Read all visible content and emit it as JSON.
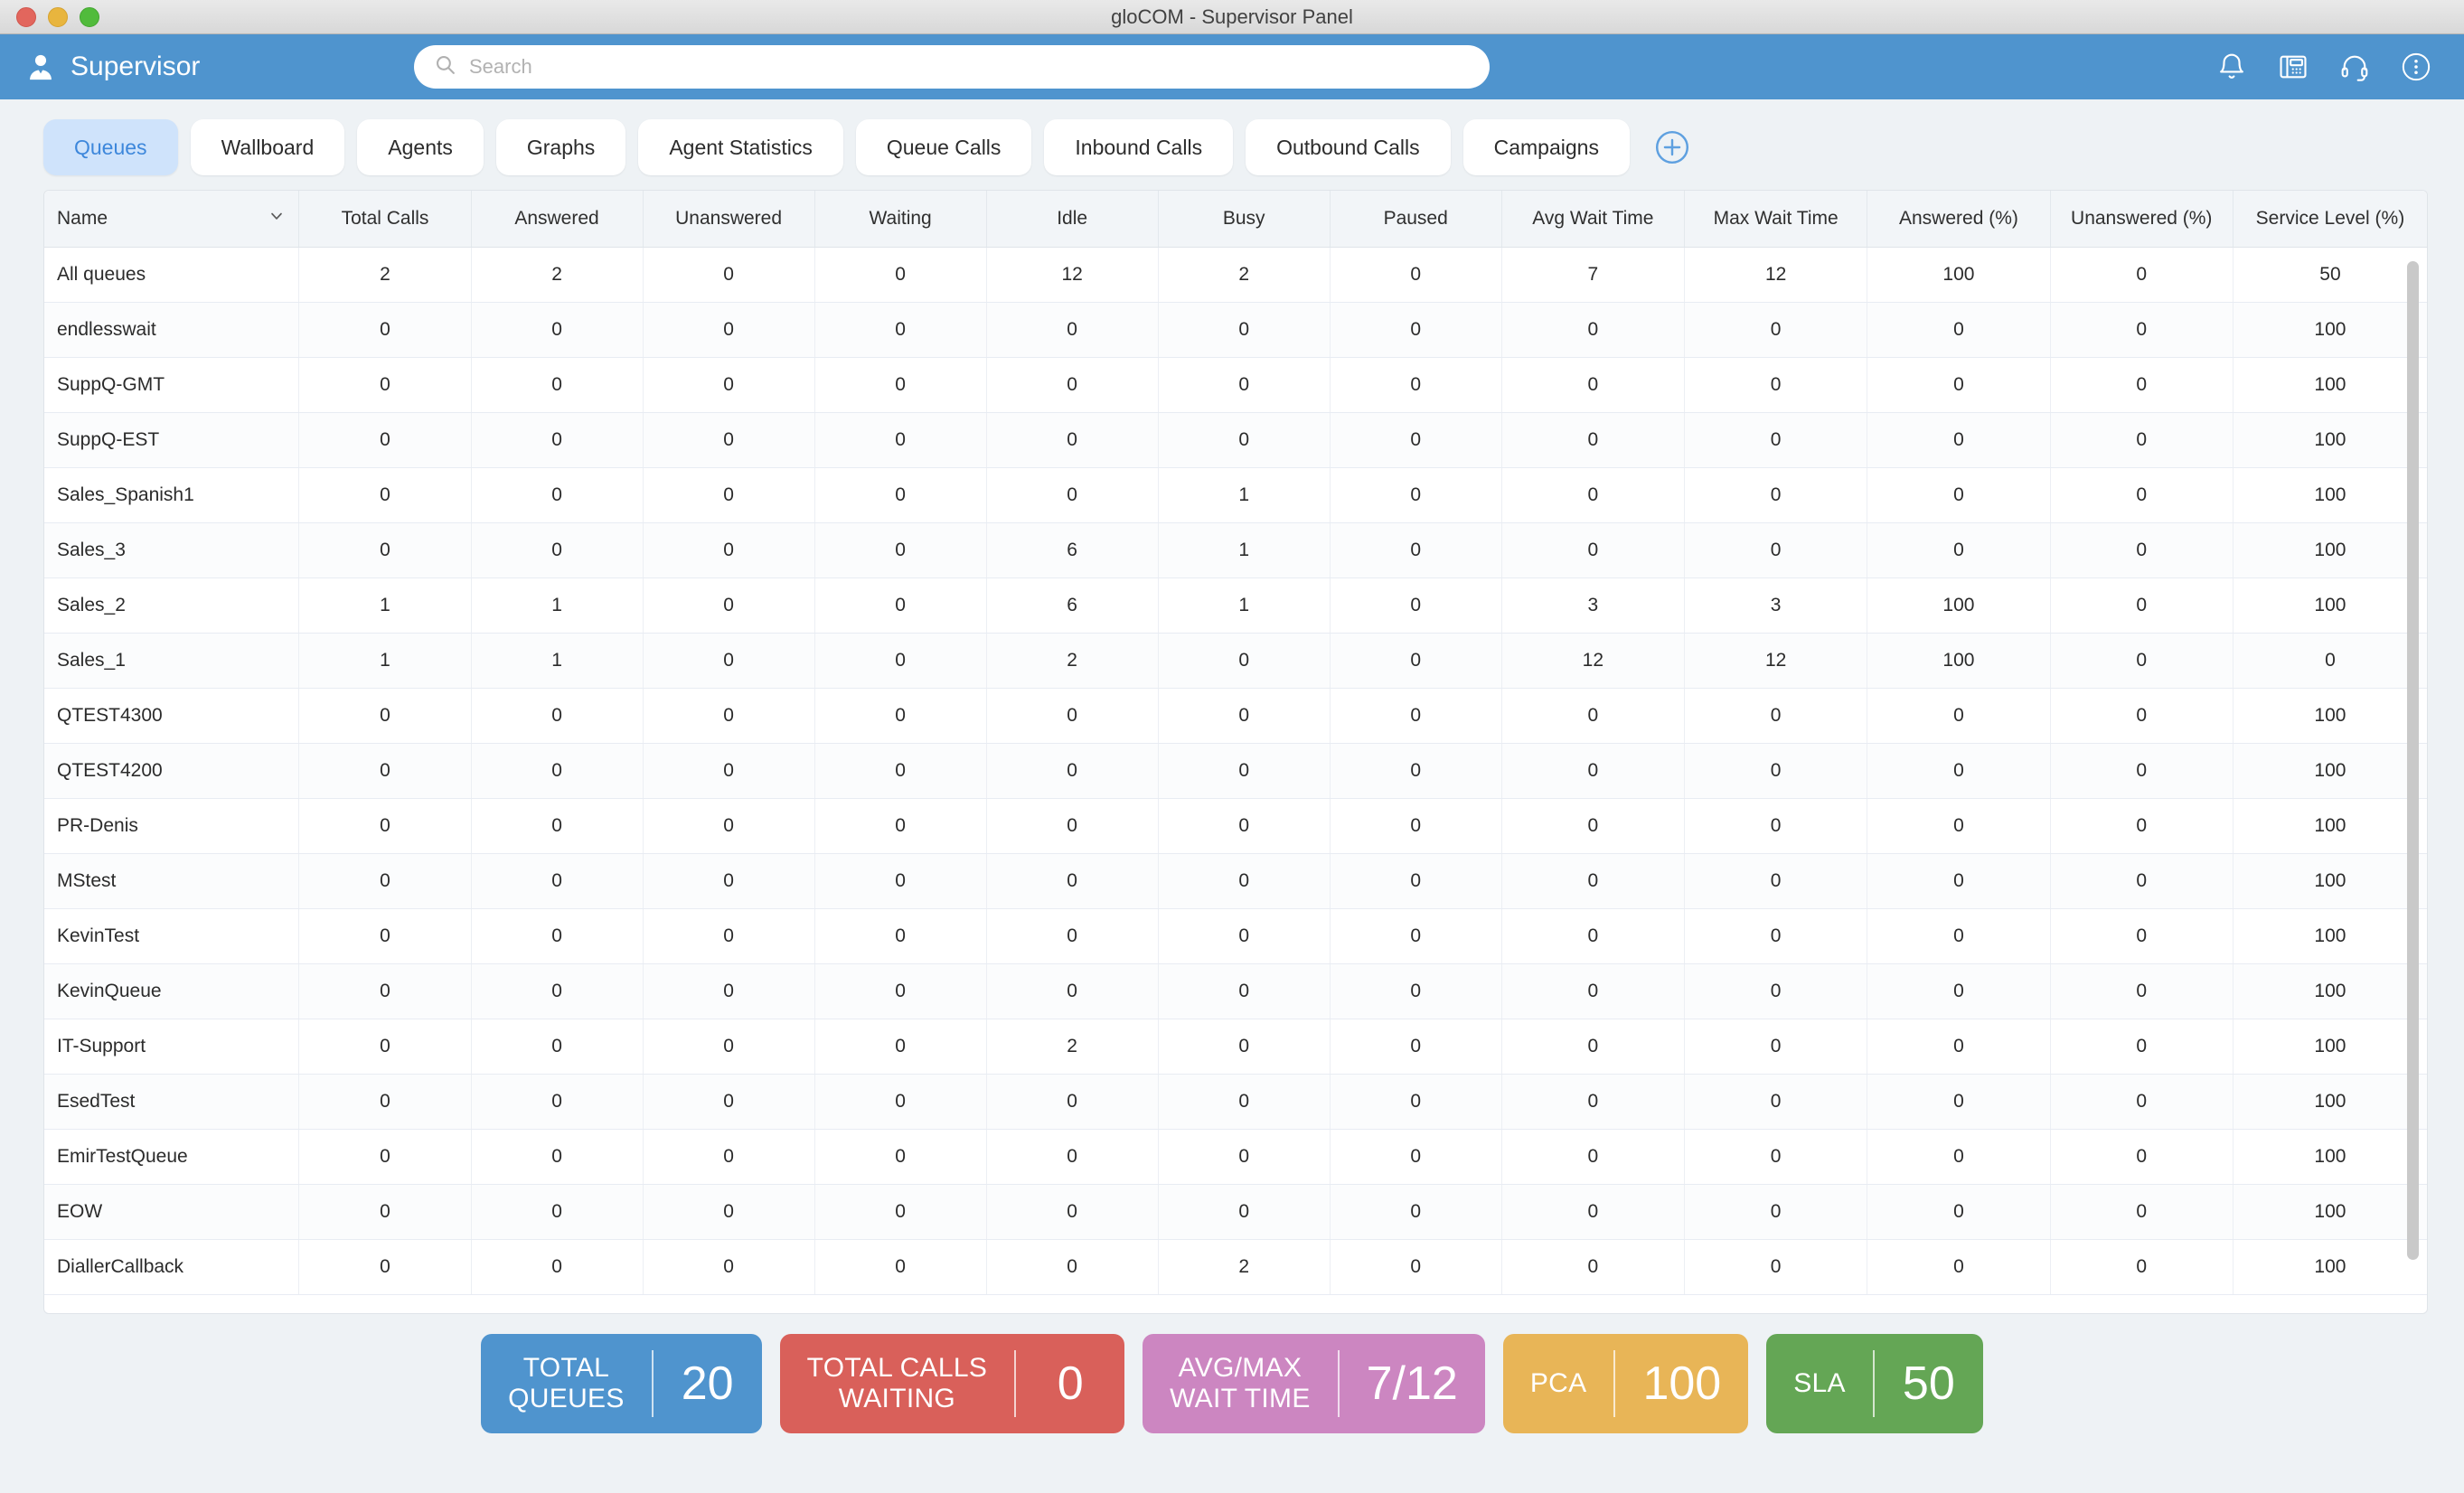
{
  "window": {
    "title": "gloCOM - Supervisor Panel",
    "controls": [
      "close",
      "minimize",
      "zoom"
    ]
  },
  "appbar": {
    "brand": "Supervisor",
    "brand_icon": "user-icon",
    "search": {
      "value": "",
      "placeholder": "Search",
      "icon": "search-icon"
    },
    "icons": [
      "bell-icon",
      "desk-phone-icon",
      "headset-icon",
      "more-options-icon"
    ],
    "background_color": "#4f94ce"
  },
  "tabs": {
    "items": [
      {
        "label": "Queues",
        "active": true
      },
      {
        "label": "Wallboard",
        "active": false
      },
      {
        "label": "Agents",
        "active": false
      },
      {
        "label": "Graphs",
        "active": false
      },
      {
        "label": "Agent Statistics",
        "active": false
      },
      {
        "label": "Queue Calls",
        "active": false
      },
      {
        "label": "Inbound Calls",
        "active": false
      },
      {
        "label": "Outbound Calls",
        "active": false
      },
      {
        "label": "Campaigns",
        "active": false
      }
    ],
    "add_tab_icon": "plus-circle-icon",
    "active_bg": "#cfe3fb",
    "active_fg": "#3d87db"
  },
  "table": {
    "sort_column": "Name",
    "sort_icon": "chevron-down-icon",
    "columns": [
      "Name",
      "Total Calls",
      "Answered",
      "Unanswered",
      "Waiting",
      "Idle",
      "Busy",
      "Paused",
      "Avg Wait Time",
      "Max Wait Time",
      "Answered (%)",
      "Unanswered (%)",
      "Service Level (%)"
    ],
    "rows": [
      {
        "name": "All queues",
        "total_calls": "2",
        "answered": "2",
        "unanswered": "0",
        "waiting": "0",
        "idle": "12",
        "busy": "2",
        "paused": "0",
        "avg_wait": "7",
        "max_wait": "12",
        "answered_pct": "100",
        "unanswered_pct": "0",
        "service_level": "50"
      },
      {
        "name": "endlesswait",
        "total_calls": "0",
        "answered": "0",
        "unanswered": "0",
        "waiting": "0",
        "idle": "0",
        "busy": "0",
        "paused": "0",
        "avg_wait": "0",
        "max_wait": "0",
        "answered_pct": "0",
        "unanswered_pct": "0",
        "service_level": "100"
      },
      {
        "name": "SuppQ-GMT",
        "total_calls": "0",
        "answered": "0",
        "unanswered": "0",
        "waiting": "0",
        "idle": "0",
        "busy": "0",
        "paused": "0",
        "avg_wait": "0",
        "max_wait": "0",
        "answered_pct": "0",
        "unanswered_pct": "0",
        "service_level": "100"
      },
      {
        "name": "SuppQ-EST",
        "total_calls": "0",
        "answered": "0",
        "unanswered": "0",
        "waiting": "0",
        "idle": "0",
        "busy": "0",
        "paused": "0",
        "avg_wait": "0",
        "max_wait": "0",
        "answered_pct": "0",
        "unanswered_pct": "0",
        "service_level": "100"
      },
      {
        "name": "Sales_Spanish1",
        "total_calls": "0",
        "answered": "0",
        "unanswered": "0",
        "waiting": "0",
        "idle": "0",
        "busy": "1",
        "paused": "0",
        "avg_wait": "0",
        "max_wait": "0",
        "answered_pct": "0",
        "unanswered_pct": "0",
        "service_level": "100"
      },
      {
        "name": "Sales_3",
        "total_calls": "0",
        "answered": "0",
        "unanswered": "0",
        "waiting": "0",
        "idle": "6",
        "busy": "1",
        "paused": "0",
        "avg_wait": "0",
        "max_wait": "0",
        "answered_pct": "0",
        "unanswered_pct": "0",
        "service_level": "100"
      },
      {
        "name": "Sales_2",
        "total_calls": "1",
        "answered": "1",
        "unanswered": "0",
        "waiting": "0",
        "idle": "6",
        "busy": "1",
        "paused": "0",
        "avg_wait": "3",
        "max_wait": "3",
        "answered_pct": "100",
        "unanswered_pct": "0",
        "service_level": "100"
      },
      {
        "name": "Sales_1",
        "total_calls": "1",
        "answered": "1",
        "unanswered": "0",
        "waiting": "0",
        "idle": "2",
        "busy": "0",
        "paused": "0",
        "avg_wait": "12",
        "max_wait": "12",
        "answered_pct": "100",
        "unanswered_pct": "0",
        "service_level": "0"
      },
      {
        "name": "QTEST4300",
        "total_calls": "0",
        "answered": "0",
        "unanswered": "0",
        "waiting": "0",
        "idle": "0",
        "busy": "0",
        "paused": "0",
        "avg_wait": "0",
        "max_wait": "0",
        "answered_pct": "0",
        "unanswered_pct": "0",
        "service_level": "100"
      },
      {
        "name": "QTEST4200",
        "total_calls": "0",
        "answered": "0",
        "unanswered": "0",
        "waiting": "0",
        "idle": "0",
        "busy": "0",
        "paused": "0",
        "avg_wait": "0",
        "max_wait": "0",
        "answered_pct": "0",
        "unanswered_pct": "0",
        "service_level": "100"
      },
      {
        "name": "PR-Denis",
        "total_calls": "0",
        "answered": "0",
        "unanswered": "0",
        "waiting": "0",
        "idle": "0",
        "busy": "0",
        "paused": "0",
        "avg_wait": "0",
        "max_wait": "0",
        "answered_pct": "0",
        "unanswered_pct": "0",
        "service_level": "100"
      },
      {
        "name": "MStest",
        "total_calls": "0",
        "answered": "0",
        "unanswered": "0",
        "waiting": "0",
        "idle": "0",
        "busy": "0",
        "paused": "0",
        "avg_wait": "0",
        "max_wait": "0",
        "answered_pct": "0",
        "unanswered_pct": "0",
        "service_level": "100"
      },
      {
        "name": "KevinTest",
        "total_calls": "0",
        "answered": "0",
        "unanswered": "0",
        "waiting": "0",
        "idle": "0",
        "busy": "0",
        "paused": "0",
        "avg_wait": "0",
        "max_wait": "0",
        "answered_pct": "0",
        "unanswered_pct": "0",
        "service_level": "100"
      },
      {
        "name": "KevinQueue",
        "total_calls": "0",
        "answered": "0",
        "unanswered": "0",
        "waiting": "0",
        "idle": "0",
        "busy": "0",
        "paused": "0",
        "avg_wait": "0",
        "max_wait": "0",
        "answered_pct": "0",
        "unanswered_pct": "0",
        "service_level": "100"
      },
      {
        "name": "IT-Support",
        "total_calls": "0",
        "answered": "0",
        "unanswered": "0",
        "waiting": "0",
        "idle": "2",
        "busy": "0",
        "paused": "0",
        "avg_wait": "0",
        "max_wait": "0",
        "answered_pct": "0",
        "unanswered_pct": "0",
        "service_level": "100"
      },
      {
        "name": "EsedTest",
        "total_calls": "0",
        "answered": "0",
        "unanswered": "0",
        "waiting": "0",
        "idle": "0",
        "busy": "0",
        "paused": "0",
        "avg_wait": "0",
        "max_wait": "0",
        "answered_pct": "0",
        "unanswered_pct": "0",
        "service_level": "100"
      },
      {
        "name": "EmirTestQueue",
        "total_calls": "0",
        "answered": "0",
        "unanswered": "0",
        "waiting": "0",
        "idle": "0",
        "busy": "0",
        "paused": "0",
        "avg_wait": "0",
        "max_wait": "0",
        "answered_pct": "0",
        "unanswered_pct": "0",
        "service_level": "100"
      },
      {
        "name": "EOW",
        "total_calls": "0",
        "answered": "0",
        "unanswered": "0",
        "waiting": "0",
        "idle": "0",
        "busy": "0",
        "paused": "0",
        "avg_wait": "0",
        "max_wait": "0",
        "answered_pct": "0",
        "unanswered_pct": "0",
        "service_level": "100"
      },
      {
        "name": "DiallerCallback",
        "total_calls": "0",
        "answered": "0",
        "unanswered": "0",
        "waiting": "0",
        "idle": "0",
        "busy": "2",
        "paused": "0",
        "avg_wait": "0",
        "max_wait": "0",
        "answered_pct": "0",
        "unanswered_pct": "0",
        "service_level": "100"
      }
    ]
  },
  "kpis": [
    {
      "label": "TOTAL\nQUEUES",
      "value": "20",
      "color": "#4f94ce"
    },
    {
      "label": "TOTAL CALLS\nWAITING",
      "value": "0",
      "color": "#d9605a"
    },
    {
      "label": "AVG/MAX\nWAIT TIME",
      "value": "7/12",
      "color": "#cc86c1"
    },
    {
      "label": "PCA",
      "value": "100",
      "color": "#e8b557"
    },
    {
      "label": "SLA",
      "value": "50",
      "color": "#64a css"
    }
  ]
}
